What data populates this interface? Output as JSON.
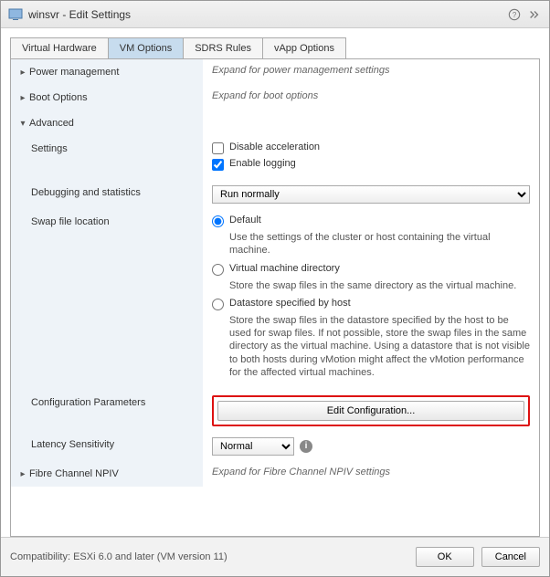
{
  "title": "winsvr - Edit Settings",
  "tabs": [
    "Virtual Hardware",
    "VM Options",
    "SDRS Rules",
    "vApp Options"
  ],
  "active_tab": 1,
  "rows": {
    "power_mgmt": {
      "label": "Power management",
      "hint": "Expand for power management settings"
    },
    "boot": {
      "label": "Boot Options",
      "hint": "Expand for boot options"
    },
    "advanced": {
      "label": "Advanced"
    },
    "settings": {
      "label": "Settings",
      "disable_accel": {
        "label": "Disable acceleration",
        "checked": false
      },
      "enable_logging": {
        "label": "Enable logging",
        "checked": true
      }
    },
    "debug": {
      "label": "Debugging and statistics",
      "value": "Run normally"
    },
    "swap": {
      "label": "Swap file location",
      "options": {
        "default": {
          "label": "Default",
          "desc": "Use the settings of the cluster or host containing the virtual machine.",
          "selected": true
        },
        "vmdir": {
          "label": "Virtual machine directory",
          "desc": "Store the swap files in the same directory as the virtual machine.",
          "selected": false
        },
        "datastore": {
          "label": "Datastore specified by host",
          "desc": "Store the swap files in the datastore specified by the host to be used for swap files. If not possible, store the swap files in the same directory as the virtual machine. Using a datastore that is not visible to both hosts during vMotion might affect the vMotion performance for the affected virtual machines.",
          "selected": false
        }
      }
    },
    "config_params": {
      "label": "Configuration Parameters",
      "button": "Edit Configuration..."
    },
    "latency": {
      "label": "Latency Sensitivity",
      "value": "Normal"
    },
    "fc_npiv": {
      "label": "Fibre Channel NPIV",
      "hint": "Expand for Fibre Channel NPIV settings"
    }
  },
  "footer": {
    "compat": "Compatibility: ESXi 6.0 and later (VM version 11)",
    "ok": "OK",
    "cancel": "Cancel"
  }
}
